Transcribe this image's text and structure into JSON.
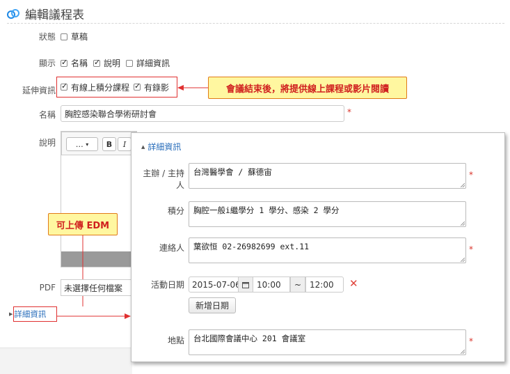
{
  "header": {
    "title": "編輯議程表"
  },
  "form": {
    "status": {
      "label": "狀態",
      "options": [
        {
          "label": "草稿",
          "checked": false
        }
      ]
    },
    "display": {
      "label": "顯示",
      "options": [
        {
          "label": "名稱",
          "checked": true
        },
        {
          "label": "說明",
          "checked": true
        },
        {
          "label": "詳細資訊",
          "checked": false
        }
      ]
    },
    "extended": {
      "label": "延伸資訊",
      "options": [
        {
          "label": "有線上積分課程",
          "checked": true
        },
        {
          "label": "有錄影",
          "checked": true
        }
      ]
    },
    "name": {
      "label": "名稱",
      "value": "胸腔感染聯合學術研討會",
      "required_mark": "*"
    },
    "description": {
      "label": "說明",
      "toolbar": {
        "format_select": "…",
        "bold": "B",
        "italic": "I"
      }
    },
    "pdf": {
      "label": "PDF",
      "value": "未選擇任何檔案"
    },
    "details_toggle": "詳細資訊"
  },
  "callouts": {
    "top": "會議結束後，將提供線上課程或影片閱讀",
    "edm": "可上傳 EDM"
  },
  "details_panel": {
    "title": "詳細資訊",
    "organizer": {
      "label": "主辦 / 主持人",
      "value": "台灣醫學會  /  蘇德宙",
      "required_mark": "*"
    },
    "credits": {
      "label": "積分",
      "value": "胸腔一般i繼學分 1 學分、感染 2 學分"
    },
    "contact": {
      "label": "連絡人",
      "value": "葉欲恒 02-26982699 ext.11",
      "required_mark": "*"
    },
    "event_date": {
      "label": "活動日期",
      "date": "2015-07-06",
      "start_time": "10:00",
      "separator": "~",
      "end_time": "12:00",
      "remove_glyph": "✕"
    },
    "add_date_button": "新增日期",
    "location": {
      "label": "地點",
      "value": "台北國際會議中心 201 會議室",
      "required_mark": "*"
    }
  },
  "colors": {
    "accent_red": "#e03030",
    "callout_bg": "#fff7a0",
    "callout_border": "#e07a17",
    "link": "#2a6ebb"
  }
}
